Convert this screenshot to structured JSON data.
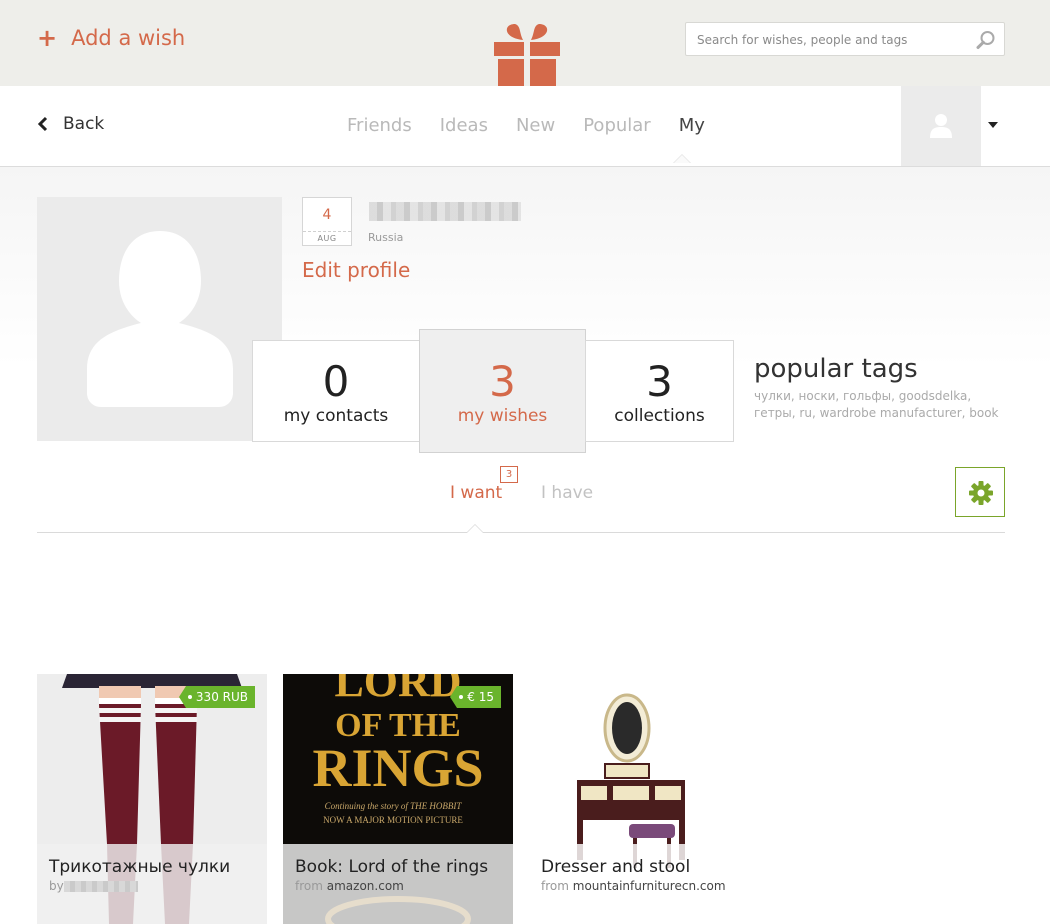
{
  "topbar": {
    "add_wish_label": "Add a wish",
    "search_placeholder": "Search for wishes, people and tags"
  },
  "nav": {
    "back_label": "Back",
    "tabs": [
      {
        "label": "Friends",
        "active": false
      },
      {
        "label": "Ideas",
        "active": false
      },
      {
        "label": "New",
        "active": false
      },
      {
        "label": "Popular",
        "active": false
      },
      {
        "label": "My",
        "active": true
      }
    ]
  },
  "profile": {
    "birthday_day": "4",
    "birthday_month": "AUG",
    "country": "Russia",
    "edit_profile_label": "Edit profile",
    "stats": {
      "contacts": {
        "value": "0",
        "label": "my contacts"
      },
      "wishes": {
        "value": "3",
        "label": "my wishes"
      },
      "collections": {
        "value": "3",
        "label": "collections"
      }
    },
    "popular_tags_title": "popular tags",
    "popular_tags_text": "чулки, носки, гольфы, goodsdelka, гетры, ru, wardrobe manufacturer, book"
  },
  "wish_tabs": {
    "want_label": "I want",
    "want_count": "3",
    "have_label": "I have"
  },
  "cards": [
    {
      "title": "Трикотажные чулки",
      "from_prefix": "by",
      "price": "330 RUB"
    },
    {
      "title": "Book: Lord of the rings",
      "from_prefix": "from",
      "source": "amazon.com",
      "price": "€ 15",
      "cover_line1": "LORD",
      "cover_line2": "OF THE",
      "cover_line3": "RINGS",
      "cover_sub1": "Continuing the story of THE HOBBIT",
      "cover_sub2": "NOW A MAJOR MOTION PICTURE"
    },
    {
      "title": "Dresser and stool",
      "from_prefix": "from",
      "source": "mountainfurniturecn.com"
    }
  ],
  "colors": {
    "accent": "#d4694a",
    "price_green": "#6ab42c",
    "settings_green": "#7aa52a"
  }
}
